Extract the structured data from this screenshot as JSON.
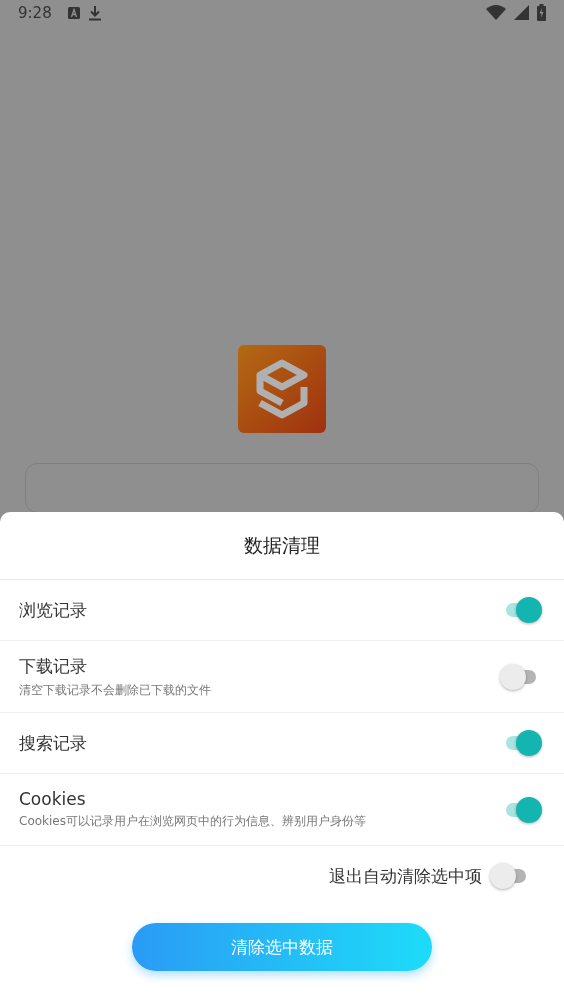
{
  "status_bar": {
    "time": "9:28"
  },
  "dialog": {
    "title": "数据清理",
    "items": [
      {
        "label": "浏览记录",
        "on": true
      },
      {
        "label": "下载记录",
        "description": "清空下载记录不会删除已下载的文件",
        "on": false
      },
      {
        "label": "搜索记录",
        "on": true
      },
      {
        "label": "Cookies",
        "description": "Cookies可以记录用户在浏览网页中的行为信息、辨别用户身份等",
        "on": true
      }
    ],
    "exit_option": {
      "label": "退出自动清除选中项",
      "on": false
    },
    "button": "清除选中数据"
  }
}
